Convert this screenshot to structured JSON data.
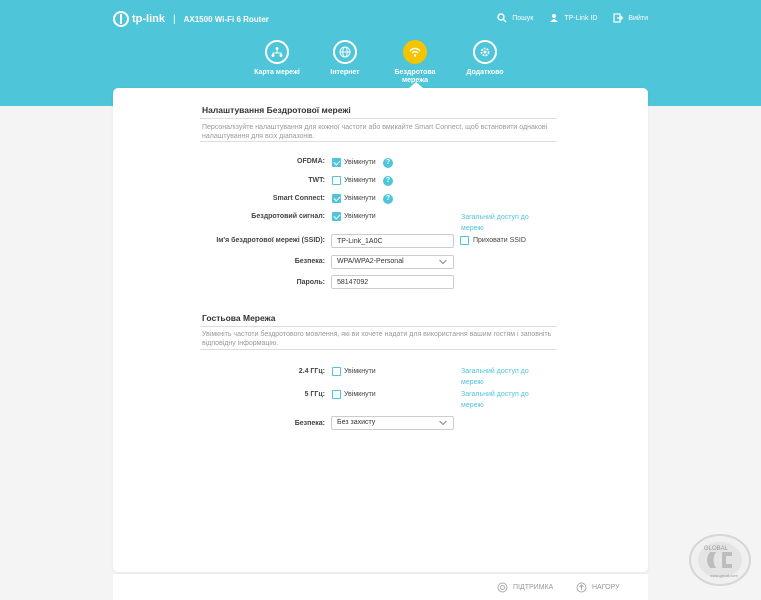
{
  "header": {
    "brand": "tp-link",
    "separator": "|",
    "model": "AX1500 Wi-Fi 6 Router",
    "links": [
      {
        "label": "Пошук",
        "icon": "search-icon"
      },
      {
        "label": "TP-Link ID",
        "icon": "user-icon"
      },
      {
        "label": "Вийти",
        "icon": "logout-icon"
      }
    ]
  },
  "nav": [
    {
      "label": "Карта мережі",
      "icon": "network-map-icon"
    },
    {
      "label": "Інтернет",
      "icon": "globe-icon"
    },
    {
      "label": "Бездротова мережа",
      "icon": "wifi-icon",
      "active": true
    },
    {
      "label": "Додатково",
      "icon": "gear-icon"
    }
  ],
  "wireless": {
    "title": "Налаштування Бездротової мережі",
    "description": "Персоналізуйте налаштування для кожної частоти або вмикайте Smart Connect, щоб встановити однакові налаштування для всіх діапазонів.",
    "ofdma_label": "OFDMA:",
    "ofdma_text": "Увімкнути",
    "twt_label": "TWT:",
    "twt_text": "Увімкнути",
    "smart_label": "Smart Connect:",
    "smart_text": "Увімкнути",
    "signal_label": "Бездротовий сигнал:",
    "signal_text": "Увімкнути",
    "share_link": "Загальний доступ до мережі",
    "ssid_label": "Ім'я бездротової мережі (SSID):",
    "ssid_value": "TP-Link_1A0C",
    "hide_ssid": "Приховати SSID",
    "security_label": "Безпека:",
    "security_value": "WPA/WPA2-Personal",
    "password_label": "Пароль:",
    "password_value": "58147092"
  },
  "guest": {
    "title": "Гостьова Мережа",
    "description": "Увімкніть частоти бездротового мовлення, які ви хочете надати для використання вашим гостям і заповніть відповідну інформацію.",
    "band24_label": "2.4 ГГц:",
    "band24_text": "Увімкнути",
    "band5_label": "5 ГГц:",
    "band5_text": "Увімкнути",
    "share_link": "Загальний доступ до мережі",
    "security_label": "Безпека:",
    "security_value": "Без захисту"
  },
  "footer": {
    "support": "ПІДТРИМКА",
    "top": "НАГОРУ"
  },
  "watermark": {
    "text": "GLOBAL",
    "site": "www.gecid.com"
  },
  "colors": {
    "accent": "#4ec5d9",
    "active_nav": "#f5c400"
  }
}
